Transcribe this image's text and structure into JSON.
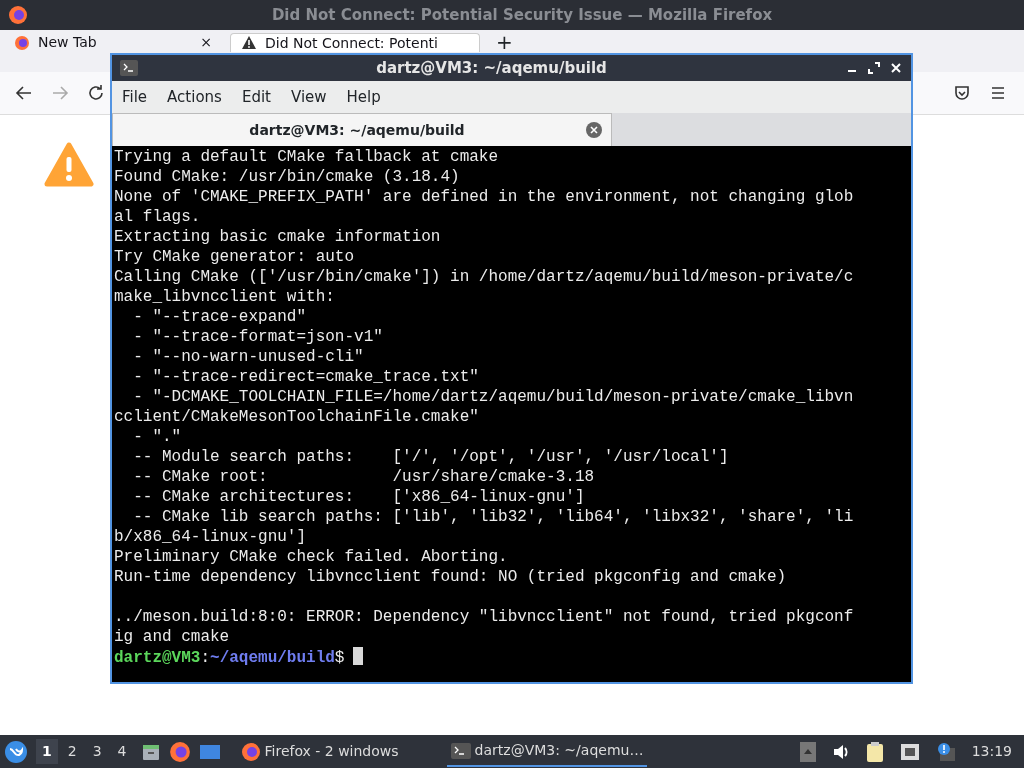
{
  "firefox": {
    "title": "Did Not Connect: Potential Security Issue — Mozilla Firefox",
    "tabs": [
      {
        "label": "New Tab",
        "selected": false,
        "close": "×"
      },
      {
        "label": "Did Not Connect: Potenti",
        "selected": true
      }
    ],
    "new_tab": "+"
  },
  "terminal": {
    "title": "dartz@VM3: ~/aqemu/build",
    "menu": [
      "File",
      "Actions",
      "Edit",
      "View",
      "Help"
    ],
    "tab": {
      "label": "dartz@VM3: ~/aqemu/build"
    },
    "blocks": [
      [
        "Trying a default CMake fallback at cmake",
        "Found CMake: /usr/bin/cmake (3.18.4)",
        "None of 'CMAKE_PREFIX_PATH' are defined in the environment, not changing glob",
        "al flags.",
        "Extracting basic cmake information",
        "Try CMake generator: auto",
        "Calling CMake (['/usr/bin/cmake']) in /home/dartz/aqemu/build/meson-private/c",
        "make_libvncclient with:",
        "  - \"--trace-expand\"",
        "  - \"--trace-format=json-v1\"",
        "  - \"--no-warn-unused-cli\"",
        "  - \"--trace-redirect=cmake_trace.txt\"",
        "  - \"-DCMAKE_TOOLCHAIN_FILE=/home/dartz/aqemu/build/meson-private/cmake_libvn",
        "cclient/CMakeMesonToolchainFile.cmake\"",
        "  - \".\"",
        "  -- Module search paths:    ['/', '/opt', '/usr', '/usr/local']",
        "  -- CMake root:             /usr/share/cmake-3.18",
        "  -- CMake architectures:    ['x86_64-linux-gnu']",
        "  -- CMake lib search paths: ['lib', 'lib32', 'lib64', 'libx32', 'share', 'li",
        "b/x86_64-linux-gnu']",
        "Preliminary CMake check failed. Aborting.",
        "Run-time dependency libvncclient found: NO (tried pkgconfig and cmake)"
      ],
      [
        "../meson.build:8:0: ERROR: Dependency \"libvncclient\" not found, tried pkgconf",
        "ig and cmake"
      ]
    ],
    "prompt": {
      "user": "dartz@VM3",
      "sep": ":",
      "path": "~/aqemu/build",
      "symbol": "$"
    }
  },
  "taskbar": {
    "workspaces": [
      {
        "label": "1",
        "selected": true
      },
      {
        "label": "2",
        "selected": false
      },
      {
        "label": "3",
        "selected": false
      },
      {
        "label": "4",
        "selected": false
      }
    ],
    "tasks": [
      {
        "kind": "firefox",
        "label": "Firefox - 2 windows",
        "selected": false
      },
      {
        "kind": "terminal",
        "label": "dartz@VM3: ~/aqemu…",
        "selected": true
      }
    ],
    "clock": "13:19"
  }
}
